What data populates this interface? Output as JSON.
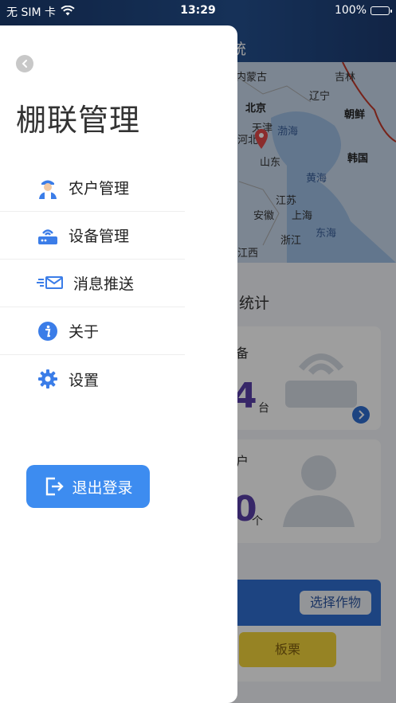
{
  "status_bar": {
    "carrier": "无 SIM 卡",
    "time": "13:29",
    "battery": "100%",
    "battery_level": 1.0
  },
  "background": {
    "header_title": "统",
    "map_labels": {
      "inner_mongolia": "内蒙古",
      "jilin": "吉林",
      "liaoning": "辽宁",
      "beijing": "北京",
      "tianjin": "天津",
      "hebei": "河北",
      "bohai": "渤海",
      "north_korea": "朝鲜",
      "shandong": "山东",
      "south_korea": "韩国",
      "yellow_sea": "黄海",
      "jiangsu": "江苏",
      "anhui": "安徽",
      "shanghai": "上海",
      "zhejiang": "浙江",
      "east_sea": "东海",
      "jiangxi": "江西"
    },
    "stats_title": "统计",
    "device_card": {
      "label": "备",
      "count": "4",
      "unit": "台"
    },
    "farmer_card": {
      "label": "户",
      "count": "0",
      "unit": "个"
    },
    "select_crop": "选择作物",
    "crop_button": "板栗"
  },
  "drawer": {
    "title": "棚联管理",
    "menu": [
      {
        "label": "农户管理",
        "icon": "farmer-icon"
      },
      {
        "label": "设备管理",
        "icon": "router-icon"
      },
      {
        "label": "消息推送",
        "icon": "message-icon"
      },
      {
        "label": "关于",
        "icon": "info-icon"
      },
      {
        "label": "设置",
        "icon": "gear-icon"
      }
    ],
    "logout_label": "退出登录"
  },
  "colors": {
    "accent": "#3d8cf0",
    "icon_blue": "#3b7de8"
  }
}
